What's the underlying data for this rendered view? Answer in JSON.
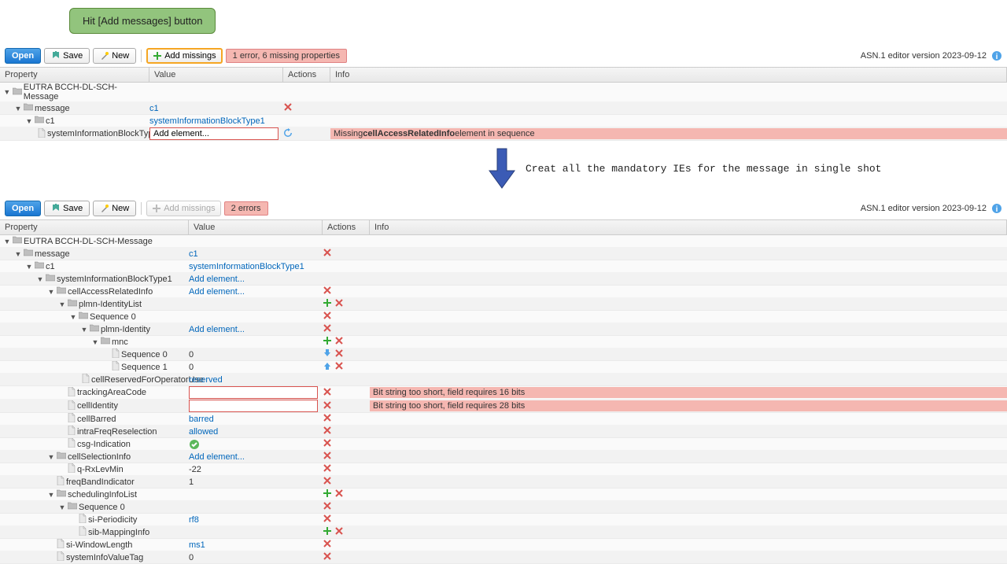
{
  "callout": "Hit [Add messages] button",
  "toolbar": {
    "open": "Open",
    "save": "Save",
    "new": "New",
    "add_missings": "Add missings",
    "err1": "1 error, 6 missing properties",
    "err2": "2 errors"
  },
  "version": "ASN.1 editor version 2023-09-12",
  "headers": {
    "property": "Property",
    "value": "Value",
    "actions": "Actions",
    "info": "Info"
  },
  "arrow_text": "Creat all the mandatory IEs for the message in single shot",
  "panel1": {
    "colw": {
      "prop": 190,
      "val": 170,
      "act": 60
    },
    "rows": [
      {
        "d": 0,
        "tw": "▼",
        "ic": "folder",
        "p": "EUTRA BCCH-DL-SCH-Message"
      },
      {
        "d": 1,
        "tw": "▼",
        "ic": "folder",
        "p": "message",
        "v": "c1",
        "vlink": true,
        "a": [
          "x"
        ]
      },
      {
        "d": 2,
        "tw": "▼",
        "ic": "folder",
        "p": "c1",
        "v": "systemInformationBlockType1",
        "vlink": true
      },
      {
        "d": 3,
        "tw": "",
        "ic": "file",
        "p": "systemInformationBlockType1",
        "v": "Add element...",
        "vinput": true,
        "a": [
          "refresh"
        ],
        "info": "Missing <b>cellAccessRelatedInfo</b> element in sequence",
        "err": true
      }
    ]
  },
  "panel2": {
    "colw": {
      "prop": 240,
      "val": 170,
      "act": 60
    },
    "rows": [
      {
        "d": 0,
        "tw": "▼",
        "ic": "folder",
        "p": "EUTRA BCCH-DL-SCH-Message"
      },
      {
        "d": 1,
        "tw": "▼",
        "ic": "folder",
        "p": "message",
        "v": "c1",
        "vlink": true,
        "a": [
          "x"
        ]
      },
      {
        "d": 2,
        "tw": "▼",
        "ic": "folder",
        "p": "c1",
        "v": "systemInformationBlockType1",
        "vlink": true
      },
      {
        "d": 3,
        "tw": "▼",
        "ic": "folder",
        "p": "systemInformationBlockType1",
        "v": "Add element...",
        "vlink": true
      },
      {
        "d": 4,
        "tw": "▼",
        "ic": "folder",
        "p": "cellAccessRelatedInfo",
        "v": "Add element...",
        "vlink": true,
        "a": [
          "x"
        ]
      },
      {
        "d": 5,
        "tw": "▼",
        "ic": "folder",
        "p": "plmn-IdentityList",
        "a": [
          "plus",
          "x"
        ]
      },
      {
        "d": 6,
        "tw": "▼",
        "ic": "folder",
        "p": "Sequence 0",
        "a": [
          "x"
        ]
      },
      {
        "d": 7,
        "tw": "▼",
        "ic": "folder",
        "p": "plmn-Identity",
        "v": "Add element...",
        "vlink": true,
        "a": [
          "x"
        ]
      },
      {
        "d": 8,
        "tw": "▼",
        "ic": "folder",
        "p": "mnc",
        "a": [
          "plus",
          "x"
        ]
      },
      {
        "d": 9,
        "tw": "",
        "ic": "file",
        "p": "Sequence 0",
        "v": "0",
        "a": [
          "down",
          "x"
        ]
      },
      {
        "d": 9,
        "tw": "",
        "ic": "file",
        "p": "Sequence 1",
        "v": "0",
        "a": [
          "up",
          "x"
        ]
      },
      {
        "d": 7,
        "tw": "",
        "ic": "file",
        "p": "cellReservedForOperatorUse",
        "v": "reserved",
        "vlink": true
      },
      {
        "d": 5,
        "tw": "",
        "ic": "file",
        "p": "trackingAreaCode",
        "vinput": true,
        "vempty": true,
        "a": [
          "x"
        ],
        "info": "Bit string too short, field requires 16 bits",
        "err": true
      },
      {
        "d": 5,
        "tw": "",
        "ic": "file",
        "p": "cellIdentity",
        "vinput": true,
        "vempty": true,
        "a": [
          "x"
        ],
        "info": "Bit string too short, field requires 28 bits",
        "err": true
      },
      {
        "d": 5,
        "tw": "",
        "ic": "file",
        "p": "cellBarred",
        "v": "barred",
        "vlink": true,
        "a": [
          "x"
        ]
      },
      {
        "d": 5,
        "tw": "",
        "ic": "file",
        "p": "intraFreqReselection",
        "v": "allowed",
        "vlink": true,
        "a": [
          "x"
        ]
      },
      {
        "d": 5,
        "tw": "",
        "ic": "file",
        "p": "csg-Indication",
        "vcheck": true,
        "a": [
          "x"
        ]
      },
      {
        "d": 4,
        "tw": "▼",
        "ic": "folder",
        "p": "cellSelectionInfo",
        "v": "Add element...",
        "vlink": true,
        "a": [
          "x"
        ]
      },
      {
        "d": 5,
        "tw": "",
        "ic": "file",
        "p": "q-RxLevMin",
        "v": "-22",
        "a": [
          "x"
        ]
      },
      {
        "d": 4,
        "tw": "",
        "ic": "file",
        "p": "freqBandIndicator",
        "v": "1",
        "a": [
          "x"
        ]
      },
      {
        "d": 4,
        "tw": "▼",
        "ic": "folder",
        "p": "schedulingInfoList",
        "a": [
          "plus",
          "x"
        ]
      },
      {
        "d": 5,
        "tw": "▼",
        "ic": "folder",
        "p": "Sequence 0",
        "a": [
          "x"
        ]
      },
      {
        "d": 6,
        "tw": "",
        "ic": "file",
        "p": "si-Periodicity",
        "v": "rf8",
        "vlink": true,
        "a": [
          "x"
        ]
      },
      {
        "d": 6,
        "tw": "",
        "ic": "file",
        "p": "sib-MappingInfo",
        "a": [
          "plus",
          "x"
        ]
      },
      {
        "d": 4,
        "tw": "",
        "ic": "file",
        "p": "si-WindowLength",
        "v": "ms1",
        "vlink": true,
        "a": [
          "x"
        ]
      },
      {
        "d": 4,
        "tw": "",
        "ic": "file",
        "p": "systemInfoValueTag",
        "v": "0",
        "a": [
          "x"
        ]
      }
    ]
  }
}
